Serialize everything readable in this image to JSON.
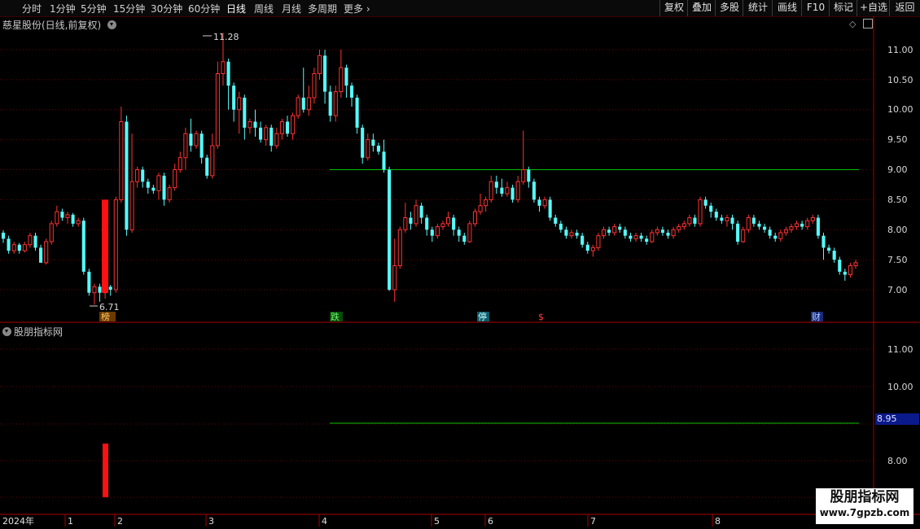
{
  "toolbar": {
    "periods": [
      "分时",
      "1分钟",
      "5分钟",
      "15分钟",
      "30分钟",
      "60分钟",
      "日线",
      "周线",
      "月线",
      "多周期",
      "更多"
    ],
    "active_period": "日线",
    "right_buttons": [
      "复权",
      "叠加",
      "多股",
      "统计",
      "画线",
      "F10",
      "标记",
      "+自选",
      "返回"
    ]
  },
  "chart_title": "慈星股份(日线,前复权)",
  "indicator_title": "股朋指标网",
  "price_axis": [
    "11.00",
    "10.50",
    "10.00",
    "9.50",
    "9.00",
    "8.50",
    "8.00",
    "7.50",
    "7.00"
  ],
  "indicator_axis": [
    "11.00",
    "10.00",
    "8.00"
  ],
  "indicator_tag": "8.95",
  "annotations": {
    "high": "11.28",
    "low": "6.71"
  },
  "markers": [
    "榜",
    "跌",
    "停",
    "$",
    "财"
  ],
  "time_axis": [
    "2024年",
    "1",
    "2",
    "3",
    "4",
    "5",
    "6",
    "7",
    "8"
  ],
  "watermark": {
    "title": "股朋指标网",
    "url": "www.7gpzb.com"
  },
  "colors": {
    "up": "#ff3232",
    "down": "#54fcfc",
    "level_line": "#00c000",
    "grid": "#6a0000"
  },
  "chart_data": {
    "type": "candlestick",
    "level": 9.0,
    "high": 11.28,
    "low": 6.71,
    "candles": [
      [
        7.95,
        7.85,
        7.99,
        7.78
      ],
      [
        7.85,
        7.65,
        7.9,
        7.6
      ],
      [
        7.65,
        7.75,
        7.8,
        7.6
      ],
      [
        7.75,
        7.65,
        7.78,
        7.6
      ],
      [
        7.65,
        7.75,
        7.8,
        7.62
      ],
      [
        7.75,
        7.9,
        7.95,
        7.7
      ],
      [
        7.9,
        7.7,
        7.95,
        7.65
      ],
      [
        7.7,
        7.45,
        7.75,
        7.45
      ],
      [
        7.45,
        7.8,
        7.85,
        7.42
      ],
      [
        7.8,
        8.1,
        8.15,
        7.75
      ],
      [
        8.1,
        8.3,
        8.4,
        8.05
      ],
      [
        8.3,
        8.2,
        8.35,
        8.15
      ],
      [
        8.2,
        8.25,
        8.3,
        8.1
      ],
      [
        8.25,
        8.1,
        8.28,
        8.05
      ],
      [
        8.1,
        8.15,
        8.2,
        8.05
      ],
      [
        8.15,
        7.3,
        8.2,
        7.25
      ],
      [
        7.3,
        6.95,
        7.35,
        6.9
      ],
      [
        6.95,
        7.05,
        7.1,
        6.75
      ],
      [
        7.05,
        6.95,
        7.1,
        6.8
      ],
      [
        6.95,
        7.05,
        7.1,
        6.85
      ],
      [
        7.05,
        7.0,
        7.08,
        6.9
      ],
      [
        7.0,
        8.5,
        8.55,
        6.95
      ],
      [
        8.5,
        9.8,
        10.05,
        8.45
      ],
      [
        9.8,
        8.0,
        9.9,
        7.9
      ],
      [
        8.0,
        8.8,
        9.6,
        7.95
      ],
      [
        8.8,
        9.0,
        9.05,
        8.7
      ],
      [
        9.0,
        8.8,
        9.05,
        8.7
      ],
      [
        8.8,
        8.7,
        8.85,
        8.6
      ],
      [
        8.7,
        8.65,
        8.75,
        8.6
      ],
      [
        8.65,
        8.9,
        8.95,
        8.5
      ],
      [
        8.9,
        8.5,
        8.95,
        8.4
      ],
      [
        8.5,
        8.7,
        8.75,
        8.45
      ],
      [
        8.7,
        9.0,
        9.1,
        8.65
      ],
      [
        9.0,
        9.2,
        9.3,
        8.95
      ],
      [
        9.2,
        9.6,
        9.7,
        9.0
      ],
      [
        9.6,
        9.4,
        9.85,
        9.3
      ],
      [
        9.4,
        9.6,
        9.65,
        9.35
      ],
      [
        9.6,
        9.2,
        9.65,
        9.1
      ],
      [
        9.2,
        8.9,
        9.25,
        8.85
      ],
      [
        8.9,
        9.4,
        9.6,
        8.85
      ],
      [
        9.4,
        10.6,
        10.8,
        9.35
      ],
      [
        10.6,
        10.8,
        11.28,
        10.4
      ],
      [
        10.8,
        10.4,
        10.85,
        10.0
      ],
      [
        10.4,
        10.0,
        10.45,
        9.8
      ],
      [
        10.0,
        10.2,
        10.3,
        9.6
      ],
      [
        10.2,
        9.7,
        10.25,
        9.5
      ],
      [
        9.7,
        9.8,
        9.85,
        9.6
      ],
      [
        9.8,
        9.7,
        10.0,
        9.55
      ],
      [
        9.7,
        9.5,
        9.8,
        9.45
      ],
      [
        9.5,
        9.7,
        9.75,
        9.4
      ],
      [
        9.7,
        9.4,
        9.75,
        9.3
      ],
      [
        9.4,
        9.6,
        9.7,
        9.35
      ],
      [
        9.6,
        9.8,
        9.85,
        9.5
      ],
      [
        9.8,
        9.6,
        9.9,
        9.55
      ],
      [
        9.6,
        9.9,
        9.95,
        9.5
      ],
      [
        9.9,
        10.2,
        10.25,
        9.85
      ],
      [
        10.2,
        10.0,
        10.7,
        9.95
      ],
      [
        10.0,
        10.2,
        10.4,
        9.9
      ],
      [
        10.2,
        10.6,
        10.7,
        10.1
      ],
      [
        10.6,
        10.9,
        11.0,
        10.5
      ],
      [
        10.9,
        10.3,
        11.0,
        10.1
      ],
      [
        10.3,
        9.9,
        10.4,
        9.8
      ],
      [
        9.9,
        10.3,
        10.4,
        9.8
      ],
      [
        10.3,
        10.7,
        11.0,
        10.2
      ],
      [
        10.7,
        10.4,
        10.75,
        10.2
      ],
      [
        10.4,
        10.2,
        10.45,
        10.05
      ],
      [
        10.2,
        9.7,
        10.25,
        9.6
      ],
      [
        9.7,
        9.2,
        9.75,
        9.1
      ],
      [
        9.2,
        9.5,
        9.6,
        9.15
      ],
      [
        9.5,
        9.4,
        9.6,
        9.3
      ],
      [
        9.4,
        9.3,
        9.45,
        9.25
      ],
      [
        9.3,
        9.0,
        9.5,
        8.95
      ],
      [
        9.0,
        7.0,
        9.05,
        6.98
      ],
      [
        7.0,
        7.4,
        7.85,
        6.8
      ],
      [
        7.4,
        8.0,
        8.05,
        7.35
      ],
      [
        8.0,
        8.2,
        8.45,
        7.95
      ],
      [
        8.2,
        8.1,
        8.3,
        8.0
      ],
      [
        8.1,
        8.4,
        8.5,
        8.05
      ],
      [
        8.4,
        8.2,
        8.45,
        8.1
      ],
      [
        8.2,
        8.0,
        8.25,
        7.9
      ],
      [
        8.0,
        7.9,
        8.05,
        7.8
      ],
      [
        7.9,
        8.05,
        8.1,
        7.85
      ],
      [
        8.05,
        8.1,
        8.15,
        8.0
      ],
      [
        8.1,
        8.2,
        8.3,
        8.05
      ],
      [
        8.2,
        8.0,
        8.25,
        7.9
      ],
      [
        8.0,
        7.9,
        8.05,
        7.8
      ],
      [
        7.9,
        7.8,
        7.95,
        7.75
      ],
      [
        7.8,
        8.1,
        8.15,
        7.78
      ],
      [
        8.1,
        8.3,
        8.35,
        8.05
      ],
      [
        8.3,
        8.4,
        8.6,
        8.25
      ],
      [
        8.4,
        8.5,
        8.55,
        8.3
      ],
      [
        8.5,
        8.8,
        8.9,
        8.45
      ],
      [
        8.8,
        8.7,
        8.9,
        8.6
      ],
      [
        8.7,
        8.6,
        8.85,
        8.55
      ],
      [
        8.6,
        8.7,
        8.8,
        8.55
      ],
      [
        8.7,
        8.5,
        8.75,
        8.45
      ],
      [
        8.5,
        8.8,
        8.9,
        8.45
      ],
      [
        8.8,
        9.0,
        9.65,
        8.75
      ],
      [
        9.0,
        8.8,
        9.05,
        8.7
      ],
      [
        8.8,
        8.5,
        8.85,
        8.45
      ],
      [
        8.5,
        8.4,
        8.55,
        8.3
      ],
      [
        8.4,
        8.5,
        8.55,
        8.35
      ],
      [
        8.5,
        8.2,
        8.55,
        8.15
      ],
      [
        8.2,
        8.1,
        8.25,
        8.05
      ],
      [
        8.1,
        8.0,
        8.15,
        7.95
      ],
      [
        8.0,
        7.9,
        8.05,
        7.85
      ],
      [
        7.9,
        7.95,
        8.0,
        7.85
      ],
      [
        7.95,
        7.9,
        8.0,
        7.85
      ],
      [
        7.9,
        7.75,
        7.95,
        7.7
      ],
      [
        7.75,
        7.65,
        7.8,
        7.6
      ],
      [
        7.65,
        7.7,
        7.75,
        7.55
      ],
      [
        7.7,
        7.9,
        7.95,
        7.65
      ],
      [
        7.9,
        8.0,
        8.05,
        7.85
      ],
      [
        8.0,
        7.95,
        8.05,
        7.9
      ],
      [
        7.95,
        8.05,
        8.1,
        7.9
      ],
      [
        8.05,
        8.0,
        8.1,
        7.95
      ],
      [
        8.0,
        7.9,
        8.05,
        7.85
      ],
      [
        7.9,
        7.85,
        7.95,
        7.8
      ],
      [
        7.85,
        7.9,
        7.95,
        7.8
      ],
      [
        7.9,
        7.85,
        7.95,
        7.8
      ],
      [
        7.85,
        7.8,
        7.9,
        7.75
      ],
      [
        7.8,
        7.95,
        8.0,
        7.78
      ],
      [
        7.95,
        8.0,
        8.05,
        7.9
      ],
      [
        8.0,
        7.95,
        8.05,
        7.9
      ],
      [
        7.95,
        7.9,
        8.0,
        7.85
      ],
      [
        7.9,
        8.0,
        8.05,
        7.85
      ],
      [
        8.0,
        8.05,
        8.1,
        7.95
      ],
      [
        8.05,
        8.1,
        8.15,
        8.0
      ],
      [
        8.1,
        8.2,
        8.25,
        8.05
      ],
      [
        8.2,
        8.1,
        8.25,
        8.05
      ],
      [
        8.1,
        8.5,
        8.55,
        8.05
      ],
      [
        8.5,
        8.4,
        8.55,
        8.35
      ],
      [
        8.4,
        8.3,
        8.45,
        8.2
      ],
      [
        8.3,
        8.2,
        8.35,
        8.15
      ],
      [
        8.2,
        8.15,
        8.25,
        8.1
      ],
      [
        8.15,
        8.2,
        8.25,
        8.05
      ],
      [
        8.2,
        8.1,
        8.25,
        8.0
      ],
      [
        8.1,
        7.8,
        8.15,
        7.75
      ],
      [
        7.8,
        8.0,
        8.05,
        7.78
      ],
      [
        8.0,
        8.2,
        8.25,
        7.95
      ],
      [
        8.2,
        8.1,
        8.25,
        8.05
      ],
      [
        8.1,
        8.05,
        8.15,
        8.0
      ],
      [
        8.05,
        8.0,
        8.1,
        7.95
      ],
      [
        8.0,
        7.9,
        8.05,
        7.85
      ],
      [
        7.9,
        7.85,
        7.95,
        7.8
      ],
      [
        7.85,
        7.95,
        8.0,
        7.8
      ],
      [
        7.95,
        8.0,
        8.05,
        7.9
      ],
      [
        8.0,
        8.05,
        8.1,
        7.95
      ],
      [
        8.05,
        8.1,
        8.15,
        8.0
      ],
      [
        8.1,
        8.05,
        8.15,
        8.0
      ],
      [
        8.05,
        8.15,
        8.2,
        8.0
      ],
      [
        8.15,
        8.2,
        8.25,
        8.1
      ],
      [
        8.2,
        7.9,
        8.25,
        7.85
      ],
      [
        7.9,
        7.7,
        7.95,
        7.5
      ],
      [
        7.7,
        7.65,
        7.75,
        7.6
      ],
      [
        7.65,
        7.5,
        7.7,
        7.45
      ],
      [
        7.5,
        7.3,
        7.55,
        7.25
      ],
      [
        7.3,
        7.25,
        7.35,
        7.15
      ],
      [
        7.25,
        7.4,
        7.45,
        7.2
      ],
      [
        7.4,
        7.45,
        7.5,
        7.35
      ]
    ]
  }
}
